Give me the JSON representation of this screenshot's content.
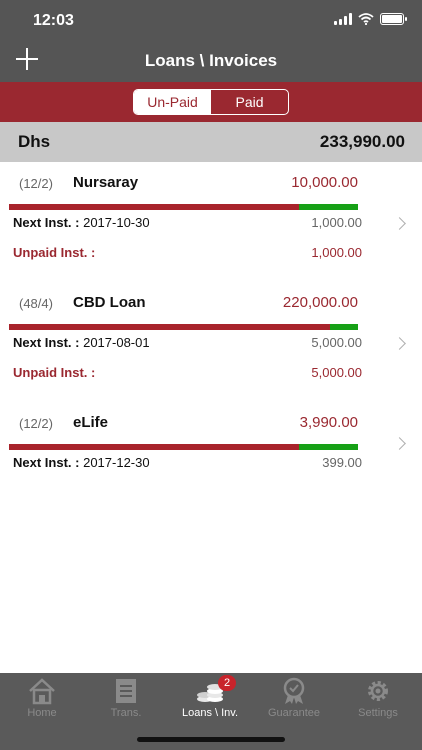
{
  "status": {
    "time": "12:03"
  },
  "header": {
    "title": "Loans \\ Invoices"
  },
  "segment": {
    "unpaid": "Un-Paid",
    "paid": "Paid"
  },
  "total": {
    "currency": "Dhs",
    "amount": "233,990.00"
  },
  "loans": [
    {
      "count": "(12/2)",
      "name": "Nursaray",
      "amount": "10,000.00",
      "paid_fraction": 0.17,
      "next_label": "Next Inst. :",
      "next_date": "2017-10-30",
      "next_amount": "1,000.00",
      "unpaid_label": "Unpaid Inst. :",
      "unpaid_amount": "1,000.00"
    },
    {
      "count": "(48/4)",
      "name": "CBD Loan",
      "amount": "220,000.00",
      "paid_fraction": 0.08,
      "next_label": "Next Inst. :",
      "next_date": "2017-08-01",
      "next_amount": "5,000.00",
      "unpaid_label": "Unpaid Inst. :",
      "unpaid_amount": "5,000.00"
    },
    {
      "count": "(12/2)",
      "name": "eLife",
      "amount": "3,990.00",
      "paid_fraction": 0.17,
      "next_label": "Next Inst. :",
      "next_date": "2017-12-30",
      "next_amount": "399.00"
    }
  ],
  "tabs": [
    {
      "label": "Home",
      "icon": "home-icon"
    },
    {
      "label": "Trans.",
      "icon": "document-icon"
    },
    {
      "label": "Loans \\ Inv.",
      "icon": "coins-icon",
      "badge": "2"
    },
    {
      "label": "Guarantee",
      "icon": "award-icon"
    },
    {
      "label": "Settings",
      "icon": "gear-icon"
    }
  ],
  "colors": {
    "header": "#555555",
    "accent": "#9a2830",
    "paid": "#16a016",
    "tabbar": "#5a5a5a"
  }
}
